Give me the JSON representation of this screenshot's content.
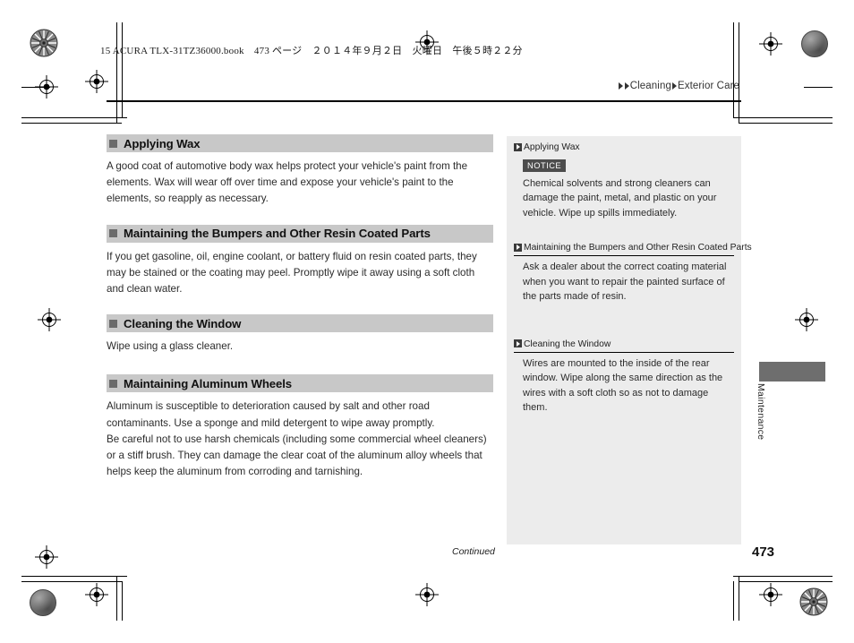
{
  "print_header": {
    "book_line": "15 ACURA TLX-31TZ36000.book　473 ページ　２０１４年９月２日　火曜日　午後５時２２分"
  },
  "breadcrumb": {
    "level1": "Cleaning",
    "level2": "Exterior Care"
  },
  "main": {
    "sections": [
      {
        "heading": "Applying Wax",
        "body": "A good coat of automotive body wax helps protect your vehicle's paint from the elements. Wax will wear off over time and expose your vehicle's paint to the elements, so reapply as necessary."
      },
      {
        "heading": "Maintaining the Bumpers and Other Resin Coated Parts",
        "body": "If you get gasoline, oil, engine coolant, or battery fluid on resin coated parts, they may be stained or the coating may peel. Promptly wipe it away using a soft cloth and clean water."
      },
      {
        "heading": "Cleaning the Window",
        "body": "Wipe using a glass cleaner."
      },
      {
        "heading": "Maintaining Aluminum Wheels",
        "body_1": "Aluminum is susceptible to deterioration caused by salt and other road contaminants. Use a sponge and mild detergent to wipe away promptly.",
        "body_2": "Be careful not to use harsh chemicals (including some commercial wheel cleaners) or a stiff brush. They can damage the clear coat of the aluminum alloy wheels that helps keep the aluminum from corroding and tarnishing."
      }
    ]
  },
  "sidebar": {
    "notes": [
      {
        "heading": "Applying Wax",
        "badge": "NOTICE",
        "text": "Chemical solvents and strong cleaners can damage the paint, metal, and plastic on your vehicle. Wipe up spills immediately.",
        "has_rule": false
      },
      {
        "heading": "Maintaining the Bumpers and Other Resin Coated Parts",
        "badge": "",
        "text": "Ask a dealer about the correct coating material when you want to repair the painted surface of the parts made of resin.",
        "has_rule": true
      },
      {
        "heading": "Cleaning the Window",
        "badge": "",
        "text": "Wires are mounted to the inside of the rear window. Wipe along the same direction as the wires with a soft cloth so as not to damage them.",
        "has_rule": true
      }
    ]
  },
  "footer": {
    "continued": "Continued",
    "page_number": "473"
  },
  "side_tab": {
    "label": "Maintenance"
  },
  "colors": {
    "heading_bar": "#c8c8c8",
    "sidebar_bg": "#ececec",
    "marker": "#3a3a3a",
    "notice_bg": "#4d4d4d",
    "tab_gray": "#6e6e6e"
  }
}
